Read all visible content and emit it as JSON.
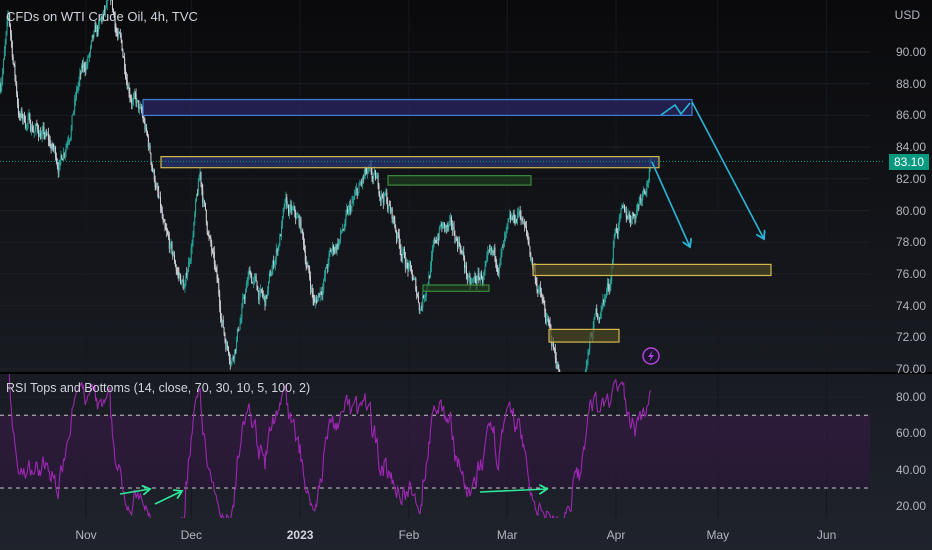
{
  "header": {
    "symbol_title": "CFDs on WTI Crude Oil, 4h, TVC",
    "currency": "USD"
  },
  "last_price": "83.10",
  "rsi_pane": {
    "title": "RSI Tops and Bottoms (14, close, 70, 30, 10, 5, 100, 2)"
  },
  "colors": {
    "up": "#26a69a",
    "down": "#d1d4dc",
    "rsi": "#9c27b0",
    "accent_cyan": "#29b6d6",
    "zone_yellow": "#d4b94a",
    "zone_green": "#3c8a3c",
    "price_tag": "#089981"
  },
  "chart_data": [
    {
      "type": "candlestick",
      "title": "CFDs on WTI Crude Oil, 4h, TVC",
      "ylabel": "USD",
      "ylim": [
        69.8,
        93.3
      ],
      "y_ticks": [
        "90.00",
        "88.00",
        "86.00",
        "84.00",
        "82.00",
        "80.00",
        "78.00",
        "76.00",
        "74.00",
        "72.00",
        "70.00"
      ],
      "x_unit": "days since 2022-10-01",
      "x_ticks": [
        {
          "label": "Nov",
          "day": 31
        },
        {
          "label": "Dec",
          "day": 61
        },
        {
          "label": "2023",
          "day": 92,
          "bold": true
        },
        {
          "label": "Feb",
          "day": 123
        },
        {
          "label": "Mar",
          "day": 151
        },
        {
          "label": "Apr",
          "day": 182
        },
        {
          "label": "May",
          "day": 211
        },
        {
          "label": "Jun",
          "day": 242
        }
      ],
      "price_path_anchors": [
        [
          6.5,
          88
        ],
        [
          9,
          92
        ],
        [
          12,
          86
        ],
        [
          18,
          85
        ],
        [
          23.6,
          83
        ],
        [
          29,
          88
        ],
        [
          37.8,
          93
        ],
        [
          43.5,
          88
        ],
        [
          47.8,
          85
        ],
        [
          50.7,
          82
        ],
        [
          53.5,
          78
        ],
        [
          59.2,
          75
        ],
        [
          63.5,
          82
        ],
        [
          66.3,
          78
        ],
        [
          70.6,
          72
        ],
        [
          72.6,
          71
        ],
        [
          77.7,
          76
        ],
        [
          82,
          74
        ],
        [
          87.7,
          80
        ],
        [
          92,
          79
        ],
        [
          96.2,
          74
        ],
        [
          100.5,
          77
        ],
        [
          104.8,
          79
        ],
        [
          110.5,
          82
        ],
        [
          116.2,
          81
        ],
        [
          120.5,
          78
        ],
        [
          126.2,
          74
        ],
        [
          131.9,
          79
        ],
        [
          137.6,
          78
        ],
        [
          140.4,
          75
        ],
        [
          144.7,
          76
        ],
        [
          149,
          77
        ],
        [
          154.7,
          80
        ],
        [
          159,
          76
        ],
        [
          163.2,
          72
        ],
        [
          167.5,
          68.5
        ],
        [
          171.8,
          68.5
        ],
        [
          176,
          73
        ],
        [
          180.3,
          75.5
        ],
        [
          181.7,
          79
        ],
        [
          187.4,
          80
        ],
        [
          190.3,
          82
        ],
        [
          192.2,
          83.1
        ]
      ],
      "last_price": 83.1,
      "zones": [
        {
          "top": 87.0,
          "bottom": 86.0,
          "color": "purple"
        },
        {
          "top": 83.4,
          "bottom": 82.7,
          "color": "blue-yellow"
        },
        {
          "top": 82.2,
          "bottom": 81.6,
          "color": "green"
        },
        {
          "top": 76.6,
          "bottom": 75.9,
          "color": "yellow"
        },
        {
          "top": 75.3,
          "bottom": 74.9,
          "color": "green"
        },
        {
          "top": 72.5,
          "bottom": 71.7,
          "color": "yellow"
        }
      ]
    },
    {
      "type": "line",
      "title": "RSI Tops and Bottoms (14, close, 70, 30, 10, 5, 100, 2)",
      "ylim": [
        15,
        88
      ],
      "y_ticks": [
        "80.00",
        "60.00",
        "40.00",
        "20.00"
      ],
      "bands": {
        "upper": 70,
        "lower": 30
      },
      "period": 14
    }
  ]
}
